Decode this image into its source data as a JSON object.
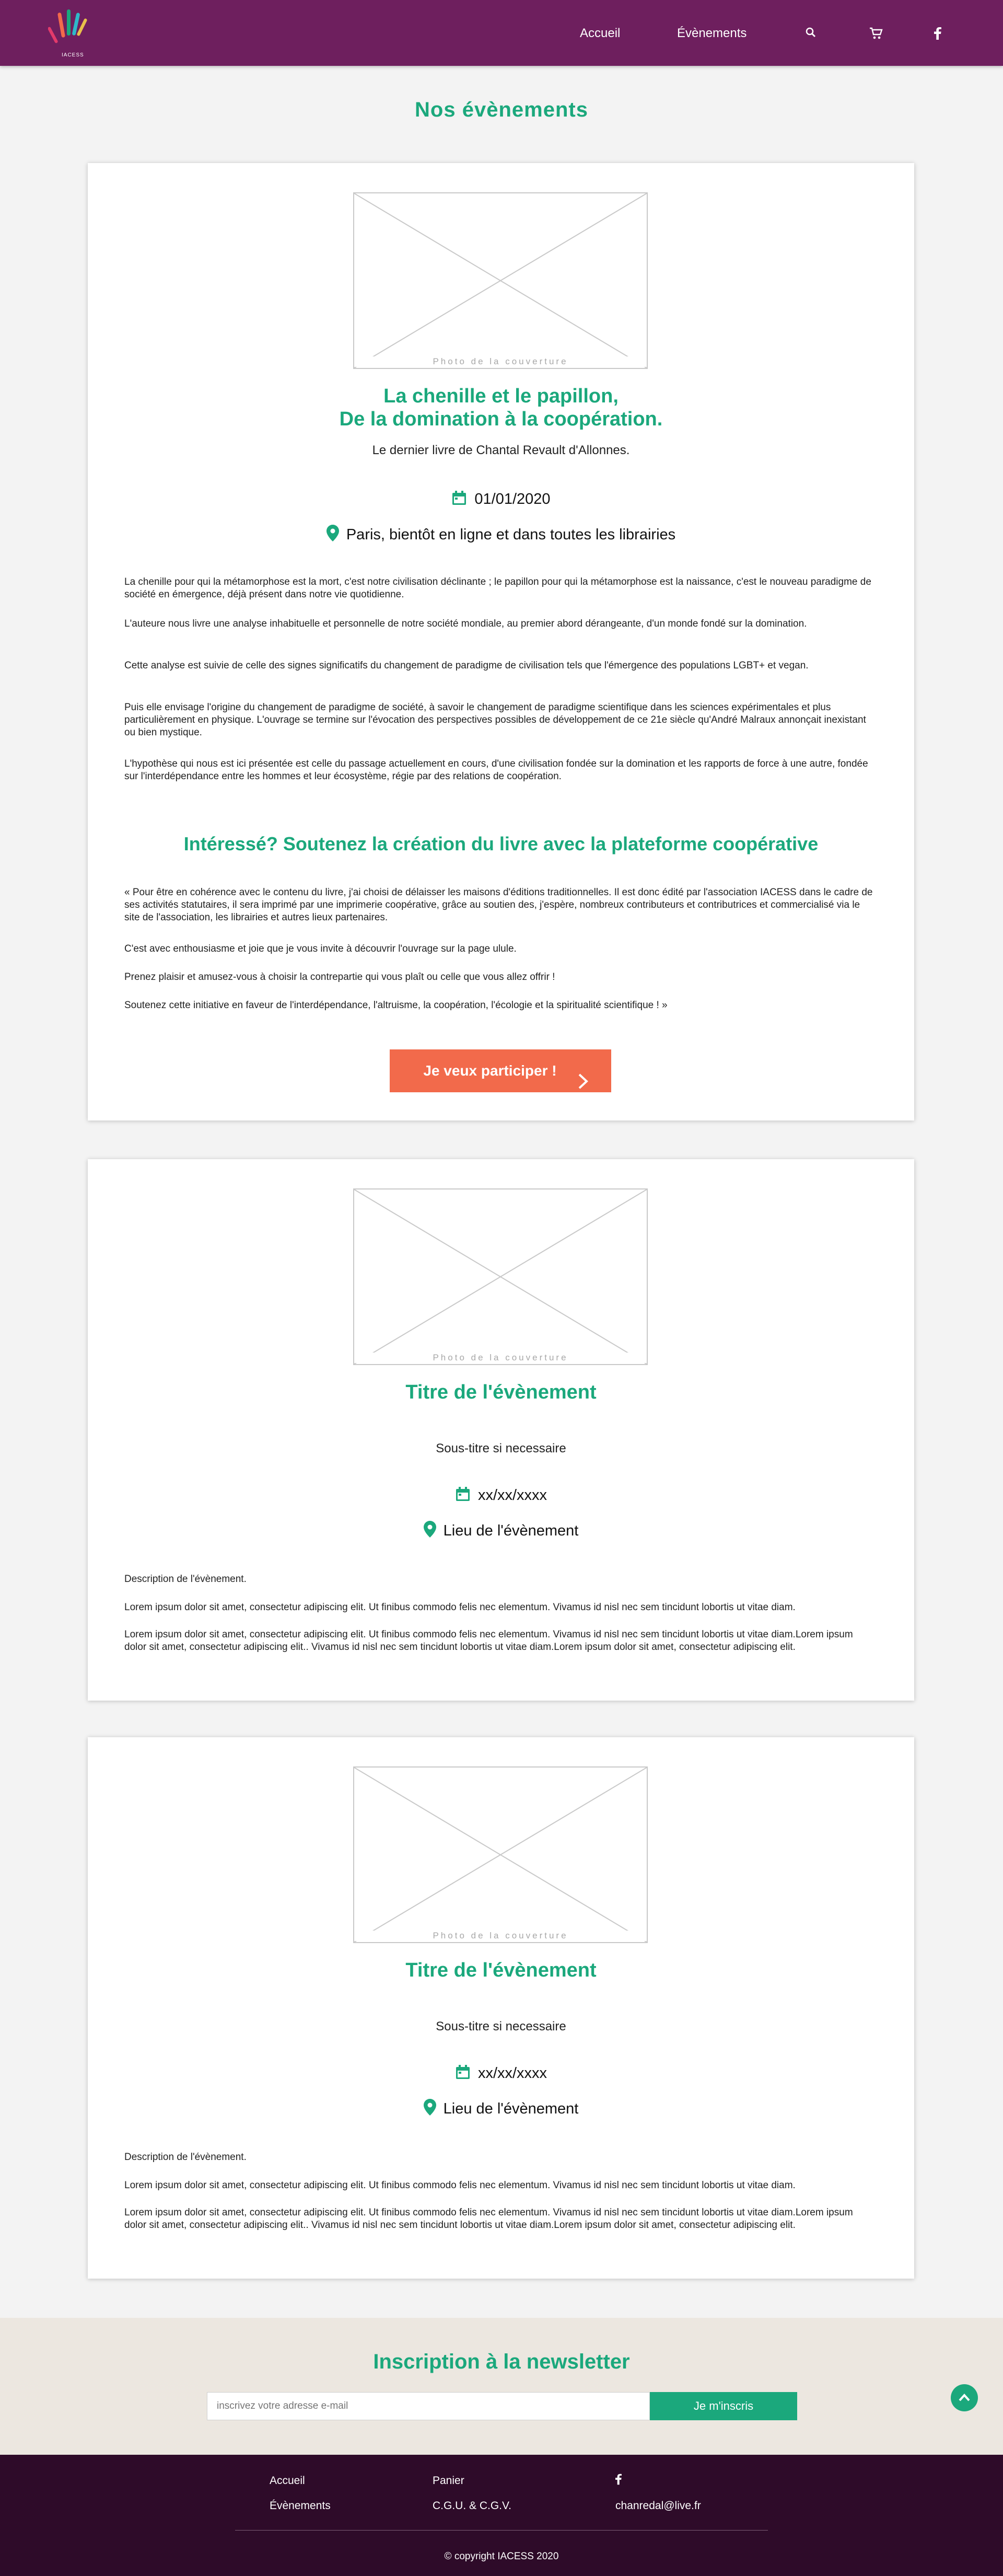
{
  "header": {
    "logo_text": "IACESS",
    "nav": [
      {
        "label": "Accueil"
      },
      {
        "label": "Évènements"
      }
    ],
    "icons": [
      "search-icon",
      "cart-icon",
      "facebook-icon"
    ],
    "background": "#6e1f5e"
  },
  "page_title": "Nos évènements",
  "events": [
    {
      "cover_caption": "Photo de la couverture",
      "title_line1": "La chenille et le papillon,",
      "title_line2": "De la domination à la coopération.",
      "subtitle": "Le dernier livre de Chantal Revault d'Allonnes.",
      "date": "01/01/2020",
      "location": "Paris, bientôt en ligne et dans toutes les librairies",
      "paragraphs": [
        "La chenille pour qui la métamorphose est la mort, c'est notre civilisation déclinante ; le papillon pour qui la métamorphose est la naissance, c'est le nouveau paradigme de société en émergence, déjà présent dans notre vie quotidienne.",
        "L'auteure nous livre une analyse inhabituelle et personnelle de notre société mondiale, au premier abord dérangeante, d'un monde fondé sur la domination.",
        "Cette analyse est suivie de celle des signes significatifs du changement de paradigme de civilisation tels que l'émergence des populations LGBT+ et vegan.",
        "Puis elle envisage l'origine du changement de paradigme de société, à savoir le changement de paradigme scientifique dans les sciences expérimentales et plus particulièrement en physique. L'ouvrage se termine sur l'évocation des perspectives possibles de développement de ce 21e siècle qu'André Malraux annonçait inexistant ou bien mystique.",
        "L'hypothèse qui nous est ici présentée est celle du passage actuellement en cours, d'une civilisation fondée sur la domination et les rapports de force à une autre, fondée sur l'interdépendance entre les hommes et leur écosystème, régie par des relations de coopération."
      ],
      "support_heading": "Intéressé? Soutenez la création du livre avec la plateforme coopérative",
      "quote_paragraphs": [
        "« Pour être en cohérence avec le contenu du livre, j'ai choisi de délaisser les maisons d'éditions traditionnelles. Il est donc édité par l'association IACESS dans le cadre de ses activités statutaires, il sera imprimé par une imprimerie coopérative, grâce au soutien des, j'espère, nombreux contributeurs et contributrices et commercialisé via le site de l'association, les librairies et autres lieux partenaires.",
        "C'est avec enthousiasme et joie que je vous invite à découvrir l'ouvrage sur la page ulule.",
        "Prenez plaisir et amusez-vous à choisir la contrepartie qui vous plaît ou celle que vous allez offrir !",
        "Soutenez cette initiative en faveur de l'interdépendance, l'altruisme, la coopération, l'écologie et la spiritualité scientifique ! »"
      ],
      "cta_label": "Je veux participer !"
    },
    {
      "cover_caption": "Photo de la couverture",
      "title": "Titre de l'évènement",
      "subtitle": "Sous-titre si necessaire",
      "date": "xx/xx/xxxx",
      "location": "Lieu de l'évènement",
      "description_label": "Description de l'évènement.",
      "paragraphs": [
        "Lorem ipsum dolor sit amet, consectetur adipiscing elit. Ut finibus commodo felis nec elementum. Vivamus id nisl nec sem tincidunt lobortis ut vitae diam.",
        "Lorem ipsum dolor sit amet, consectetur adipiscing elit. Ut finibus commodo felis nec elementum. Vivamus id nisl nec sem tincidunt lobortis ut vitae diam.Lorem ipsum dolor sit amet, consectetur adipiscing elit.. Vivamus id nisl nec sem tincidunt lobortis ut vitae diam.Lorem ipsum dolor sit amet, consectetur adipiscing elit."
      ]
    },
    {
      "cover_caption": "Photo de la couverture",
      "title": "Titre de l'évènement",
      "subtitle": "Sous-titre si necessaire",
      "date": "xx/xx/xxxx",
      "location": "Lieu de l'évènement",
      "description_label": "Description de l'évènement.",
      "paragraphs": [
        "Lorem ipsum dolor sit amet, consectetur adipiscing elit. Ut finibus commodo felis nec elementum. Vivamus id nisl nec sem tincidunt lobortis ut vitae diam.",
        "Lorem ipsum dolor sit amet, consectetur adipiscing elit. Ut finibus commodo felis nec elementum. Vivamus id nisl nec sem tincidunt lobortis ut vitae diam.Lorem ipsum dolor sit amet, consectetur adipiscing elit.. Vivamus id nisl nec sem tincidunt lobortis ut vitae diam.Lorem ipsum dolor sit amet, consectetur adipiscing elit."
      ]
    }
  ],
  "newsletter": {
    "title": "Inscription à la newsletter",
    "placeholder": "inscrivez votre adresse e-mail",
    "button": "Je m'inscris"
  },
  "footer": {
    "links": [
      "Accueil",
      "Évènements",
      "Panier",
      "C.G.U. & C.G.V."
    ],
    "email": "chanredal@live.fr",
    "copyright": "© copyright IACESS 2020"
  },
  "colors": {
    "accent": "#1ba87c",
    "header": "#6e1f5e",
    "footer": "#2e0b29",
    "cta": "#f26a4b",
    "newsletter_bg": "#ece7e0"
  }
}
